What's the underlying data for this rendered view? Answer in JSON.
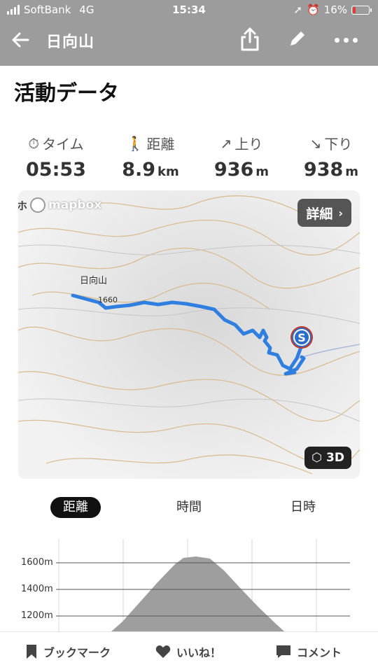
{
  "status": {
    "carrier": "SoftBank",
    "network": "4G",
    "time": "15:34",
    "battery": "16%"
  },
  "header": {
    "title": "日向山"
  },
  "section": {
    "title": "活動データ"
  },
  "stats": [
    {
      "label": "タイム",
      "value": "05:53",
      "unit": ""
    },
    {
      "label": "距離",
      "value": "8.9",
      "unit": "km"
    },
    {
      "label": "上り",
      "value": "936",
      "unit": "m"
    },
    {
      "label": "下り",
      "value": "938",
      "unit": "m"
    }
  ],
  "map": {
    "attribution": "mapbox",
    "detail_label": "詳細",
    "view3d_label": "3D",
    "peak_label": "日向山",
    "contour_label": "1660",
    "start_marker": "S",
    "partial_text": "ホ"
  },
  "tabs": [
    {
      "label": "距離",
      "active": true
    },
    {
      "label": "時間",
      "active": false
    },
    {
      "label": "日時",
      "active": false
    }
  ],
  "elevation": {
    "y_ticks": [
      "1600m",
      "1400m",
      "1200m"
    ]
  },
  "bottom": {
    "bookmark": "ブックマーク",
    "like": "いいね！",
    "comment": "コメント"
  },
  "colors": {
    "route": "#2f7fe0",
    "header_bg": "#9c9c9c",
    "battery_low": "#e53935"
  }
}
